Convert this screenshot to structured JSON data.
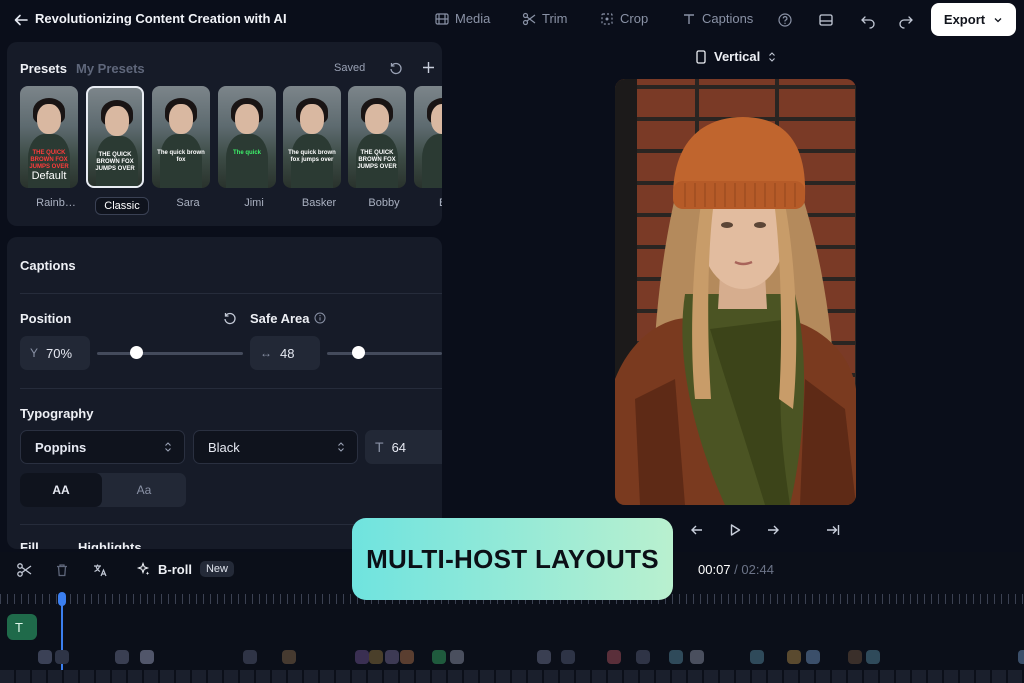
{
  "header": {
    "title": "Revolutionizing Content Creation with AI",
    "tools": [
      {
        "label": "Media",
        "icon": "media-icon"
      },
      {
        "label": "Trim",
        "icon": "scissors-icon"
      },
      {
        "label": "Crop",
        "icon": "crop-icon"
      },
      {
        "label": "Captions",
        "icon": "text-icon"
      }
    ],
    "export_label": "Export"
  },
  "presets": {
    "tab_active": "Presets",
    "tab_inactive": "My Presets",
    "status": "Saved",
    "items": [
      {
        "label": "Rainb…",
        "badge": "Default",
        "caption": "THE QUICK BROWN FOX JUMPS OVER",
        "caption_color": "#ff3b3b"
      },
      {
        "label": "Classic",
        "badge": "",
        "caption": "THE QUICK BROWN FOX JUMPS OVER",
        "caption_color": "#ffffff"
      },
      {
        "label": "Sara",
        "badge": "",
        "caption": "The quick brown fox",
        "caption_color": "#ffffff"
      },
      {
        "label": "Jimi",
        "badge": "",
        "caption": "The quick",
        "caption_color": "#3df06a"
      },
      {
        "label": "Basker",
        "badge": "",
        "caption": "The quick brown fox jumps over",
        "caption_color": "#ffffff"
      },
      {
        "label": "Bobby",
        "badge": "",
        "caption": "THE QUICK BROWN FOX JUMPS OVER",
        "caption_color": "#ffffff"
      },
      {
        "label": "Br…",
        "badge": "",
        "caption": "",
        "caption_color": "#ffffff"
      }
    ]
  },
  "captions": {
    "title": "Captions",
    "position": {
      "title": "Position",
      "axis": "Y",
      "value": "70%",
      "slider_fraction": 0.27
    },
    "safe_area": {
      "title": "Safe Area",
      "value": "48",
      "slider_fraction": 0.27
    },
    "typography": {
      "title": "Typography",
      "font": "Poppins",
      "weight": "Black",
      "size": "64",
      "case_upper": "AA",
      "case_title": "Aa"
    },
    "next_section": {
      "fill": "Fill",
      "highlights": "Highlights"
    }
  },
  "preview": {
    "aspect_label": "Vertical"
  },
  "overlay": {
    "text": "MULTI-HOST LAYOUTS"
  },
  "timeline": {
    "broll_label": "B-roll",
    "broll_badge": "New",
    "current_time": "00:07",
    "separator": "/",
    "total_time": "02:44",
    "text_track": "T"
  },
  "colors": {
    "background": "#0a0e1a",
    "panel": "#161b28",
    "accent_playhead": "#3b7ff0",
    "overlay_gradient_start": "#6fe3df",
    "overlay_gradient_end": "#b9f0cf",
    "text_track": "#1f6a4a"
  }
}
